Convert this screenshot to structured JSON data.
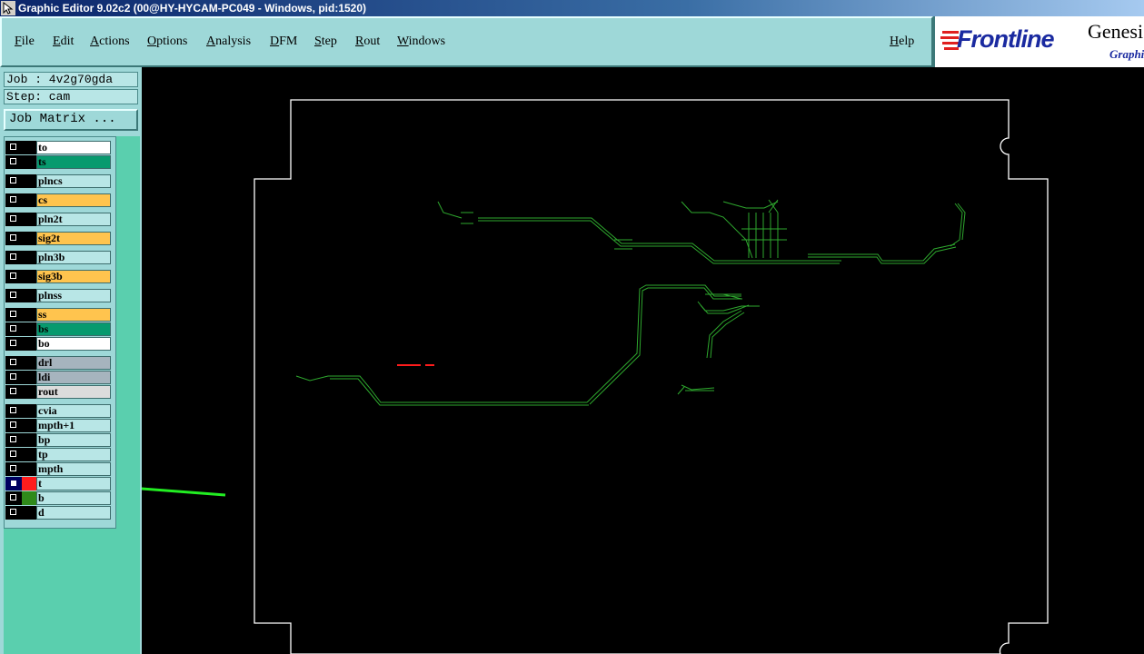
{
  "window": {
    "title": "Graphic Editor 9.02c2 (00@HY-HYCAM-PC049 - Windows, pid:1520)"
  },
  "menu": {
    "file": "File",
    "edit": "Edit",
    "actions": "Actions",
    "options": "Options",
    "analysis": "Analysis",
    "dfm": "DFM",
    "step": "Step",
    "rout": "Rout",
    "windows": "Windows",
    "help": "Help"
  },
  "logo": {
    "brand": "Frontline",
    "product": "Genesis",
    "subtitle": "Graphic"
  },
  "job": {
    "label": "Job : 4v2g70gda",
    "step": "Step: cam",
    "matrix_button": "Job Matrix ..."
  },
  "colors": {
    "white": "#ffffff",
    "green": "#079a6e",
    "orange": "#ffc44e",
    "light": "#b8e6e6",
    "grey": "#a6b4be",
    "silver": "#dcdcdc",
    "red": "#ff1c1c",
    "olive": "#2f8a1a",
    "trace": "#2ea82e",
    "outline": "#ffffff",
    "arrow": "#22ee22"
  },
  "layers": [
    {
      "name": "to",
      "color": "#ffffff"
    },
    {
      "name": "ts",
      "color": "#079a6e"
    },
    {
      "name": "plncs",
      "color": "#b8e6e6"
    },
    {
      "name": "cs",
      "color": "#ffc44e"
    },
    {
      "name": "pln2t",
      "color": "#b8e6e6"
    },
    {
      "name": "sig2t",
      "color": "#ffc44e"
    },
    {
      "name": "pln3b",
      "color": "#b8e6e6"
    },
    {
      "name": "sig3b",
      "color": "#ffc44e"
    },
    {
      "name": "plnss",
      "color": "#b8e6e6"
    },
    {
      "name": "ss",
      "color": "#ffc44e"
    },
    {
      "name": "bs",
      "color": "#079a6e"
    },
    {
      "name": "bo",
      "color": "#ffffff"
    },
    {
      "name": "drl",
      "color": "#a6b4be"
    },
    {
      "name": "ldi",
      "color": "#a6b4be"
    },
    {
      "name": "rout",
      "color": "#dcdcdc"
    },
    {
      "name": "cvia",
      "color": "#b8e6e6"
    },
    {
      "name": "mpth+1",
      "color": "#b8e6e6"
    },
    {
      "name": "bp",
      "color": "#b8e6e6"
    },
    {
      "name": "tp",
      "color": "#b8e6e6"
    },
    {
      "name": "mpth",
      "color": "#b8e6e6"
    },
    {
      "name": "t",
      "color": "#b8e6e6",
      "display_color": "#ff1c1c",
      "active": true
    },
    {
      "name": "b",
      "color": "#b8e6e6",
      "display_color": "#2f8a1a"
    },
    {
      "name": "d",
      "color": "#b8e6e6"
    }
  ]
}
